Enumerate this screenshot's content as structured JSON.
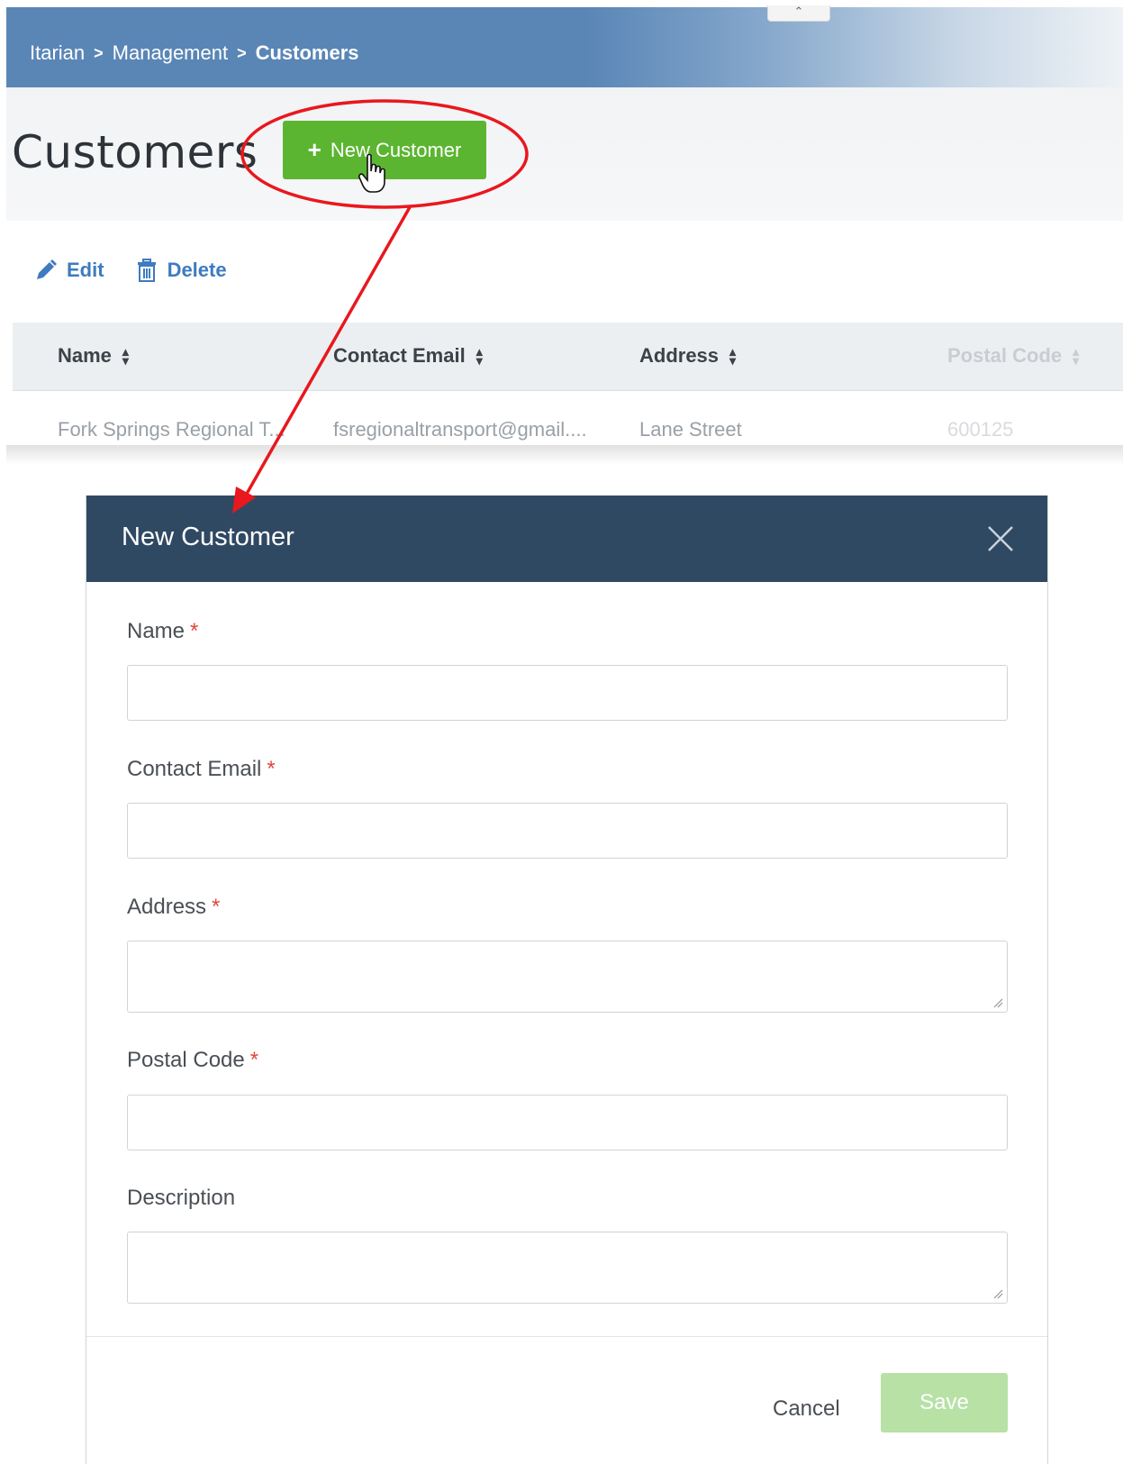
{
  "breadcrumb": {
    "items": [
      "Itarian",
      "Management"
    ],
    "current": "Customers",
    "separator": ">"
  },
  "page": {
    "title": "Customers",
    "new_button_label": "New Customer"
  },
  "toolbar": {
    "edit_label": "Edit",
    "delete_label": "Delete"
  },
  "table": {
    "columns": [
      "Name",
      "Contact Email",
      "Address",
      "Postal Code"
    ],
    "rows": [
      [
        "Fork Springs Regional T...",
        "fsregionaltransport@gmail....",
        "Lane Street",
        "600125"
      ]
    ]
  },
  "modal": {
    "title": "New Customer",
    "required_marker": "*",
    "fields": {
      "name_label": "Name",
      "email_label": "Contact Email",
      "address_label": "Address",
      "postal_label": "Postal Code",
      "description_label": "Description"
    },
    "cancel_label": "Cancel",
    "save_label": "Save"
  },
  "colors": {
    "header_blue": "#5a86b6",
    "primary_green": "#5cb531",
    "modal_header": "#304962",
    "link_blue": "#3e7bbf",
    "required_red": "#e0463d",
    "annotation_red": "#e8181e"
  }
}
